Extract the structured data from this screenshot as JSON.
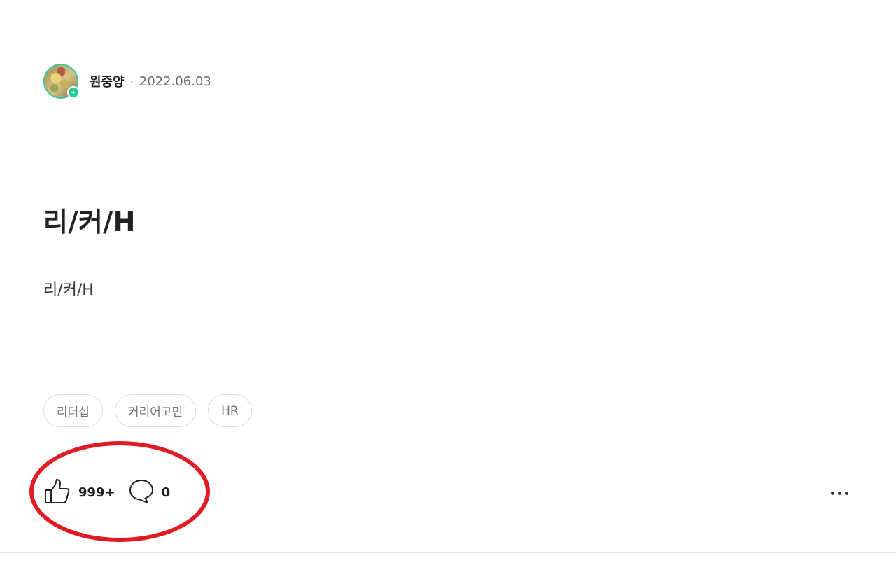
{
  "author": {
    "name": "원중양",
    "separator": "·",
    "date": "2022.06.03"
  },
  "post": {
    "title": "리/커/H",
    "body": "리/커/H"
  },
  "tags": [
    "리더십",
    "커리어고민",
    "HR"
  ],
  "actions": {
    "like_count": "999+",
    "comment_count": "0"
  },
  "icons": {
    "like": "thumbs-up-icon",
    "comment": "speech-bubble-icon",
    "more": "more-horizontal-icon",
    "badge": "verified-badge-icon"
  },
  "colors": {
    "annotation": "#e01b24",
    "badge": "#20c997",
    "avatar_ring": "#3bc8a0"
  }
}
